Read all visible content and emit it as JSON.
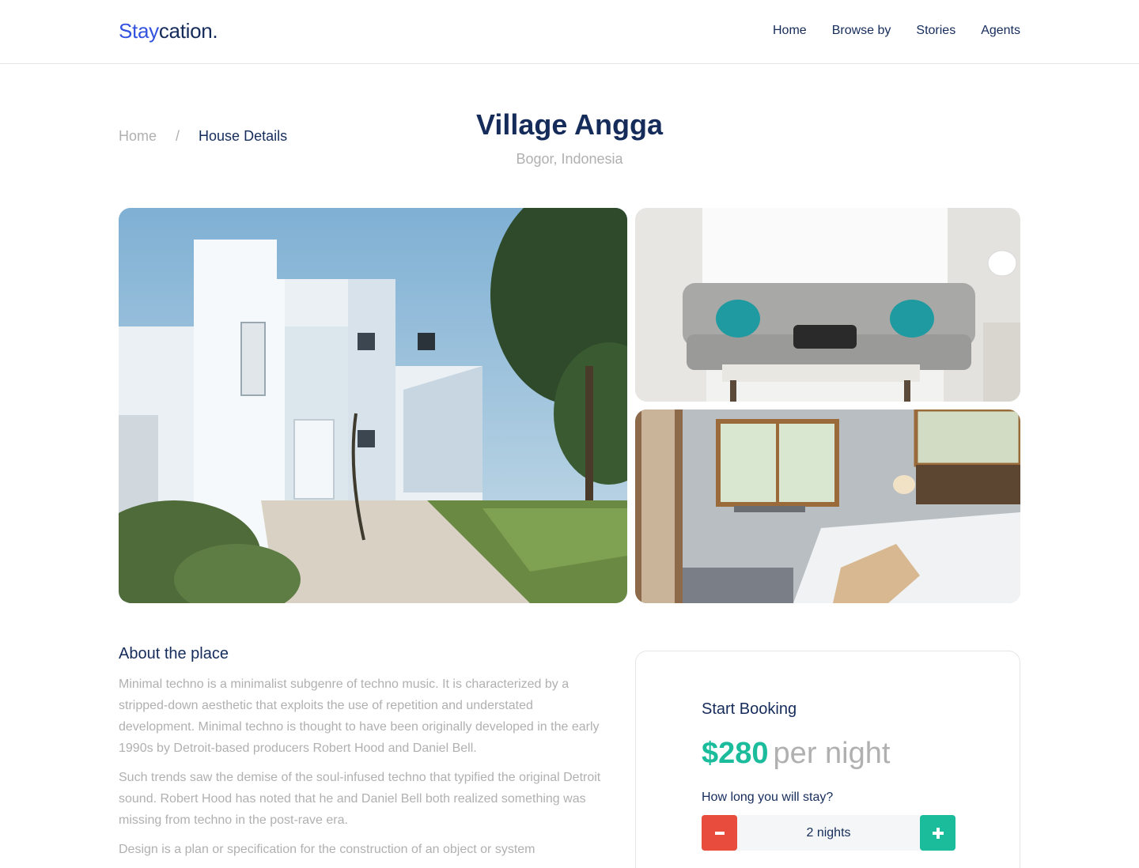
{
  "header": {
    "logo_primary": "Stay",
    "logo_secondary": "cation.",
    "nav": [
      {
        "label": "Home"
      },
      {
        "label": "Browse by"
      },
      {
        "label": "Stories"
      },
      {
        "label": "Agents"
      }
    ]
  },
  "breadcrumb": {
    "home": "Home",
    "separator": "/",
    "current": "House Details"
  },
  "page": {
    "title": "Village Angga",
    "subtitle": "Bogor, Indonesia"
  },
  "about": {
    "heading": "About the place",
    "paragraphs": [
      "Minimal techno is a minimalist subgenre of techno music. It is characterized by a stripped-down aesthetic that exploits the use of repetition and understated development. Minimal techno is thought to have been originally developed in the early 1990s by Detroit-based producers Robert Hood and Daniel Bell.",
      "Such trends saw the demise of the soul-infused techno that typified the original Detroit sound. Robert Hood has noted that he and Daniel Bell both realized something was missing from techno in the post-rave era.",
      "Design is a plan or specification for the construction of an object or system"
    ]
  },
  "booking": {
    "title": "Start Booking",
    "price": "$280",
    "price_unit": "per night",
    "duration_label": "How long you will stay?",
    "duration_value": "2 nights"
  },
  "icons": {
    "minus": "minus-icon",
    "plus": "plus-icon"
  },
  "colors": {
    "primary_text": "#152C5B",
    "brand_blue": "#3252DF",
    "muted": "#B0B0B0",
    "price_green": "#1ABC9C",
    "minus_red": "#E74C3C"
  }
}
